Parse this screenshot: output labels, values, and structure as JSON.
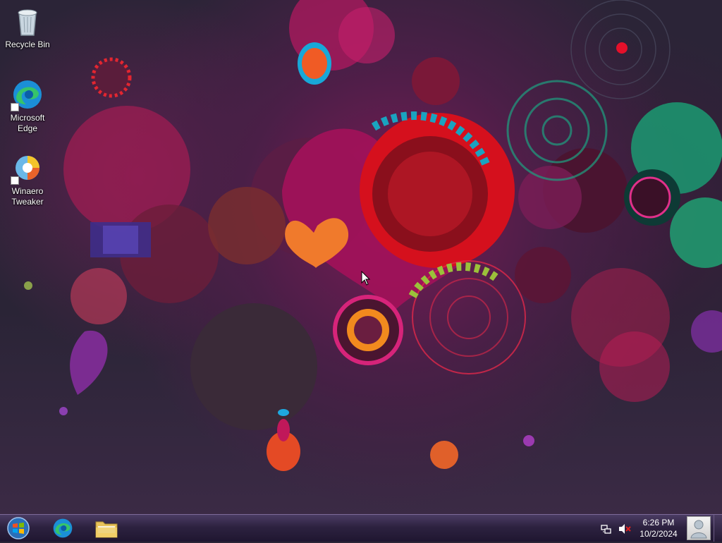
{
  "desktop": {
    "icons": [
      {
        "label": "Recycle Bin",
        "icon": "recycle-bin-icon"
      },
      {
        "label": "Microsoft\nEdge",
        "icon": "edge-icon"
      },
      {
        "label": "Winaero\nTweaker",
        "icon": "winaero-tweaker-icon"
      }
    ]
  },
  "taskbar": {
    "start_icon": "windows-orb-icon",
    "pinned": [
      {
        "name": "Microsoft Edge",
        "icon": "edge-icon"
      },
      {
        "name": "File Explorer",
        "icon": "folder-icon"
      }
    ],
    "tray": {
      "network_icon": "network-icon",
      "volume_icon": "volume-muted-icon",
      "time": "6:26 PM",
      "date": "10/2/2024",
      "user_icon": "user-avatar-icon"
    }
  },
  "colors": {
    "taskbar_top": "#4b3c63",
    "taskbar_bottom": "#1f1630",
    "wallpaper_base": "#2a2436",
    "accent_magenta": "#e0157a",
    "accent_red": "#e01b1b",
    "accent_teal": "#1fa37a"
  }
}
